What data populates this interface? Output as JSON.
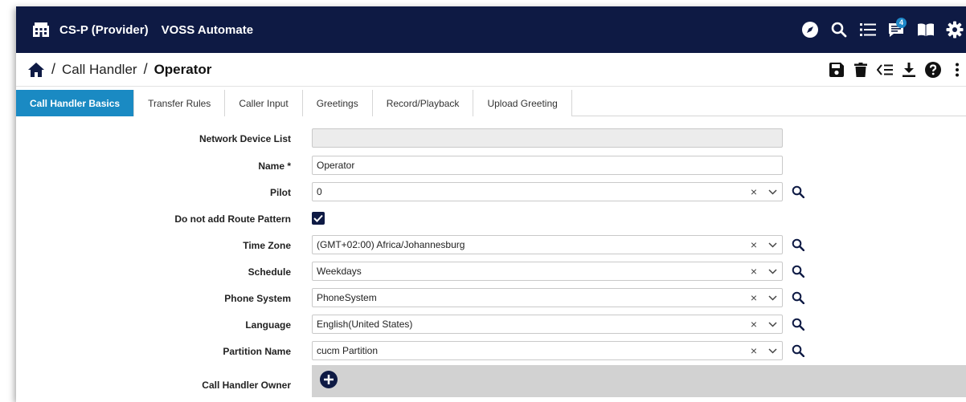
{
  "topbar": {
    "provider": "CS-P (Provider)",
    "product": "VOSS Automate",
    "notifications_count": "4",
    "icons": [
      "building-icon",
      "compass-icon",
      "search-icon",
      "list-icon",
      "chat-icon",
      "book-icon",
      "gear-icon"
    ]
  },
  "breadcrumb": {
    "separator": "/",
    "parent": "Call Handler",
    "current": "Operator"
  },
  "actions": [
    "save-icon",
    "delete-icon",
    "list-collapse-icon",
    "download-icon",
    "help-icon",
    "more-vertical-icon"
  ],
  "tabs": [
    {
      "label": "Call Handler Basics",
      "active": true
    },
    {
      "label": "Transfer Rules",
      "active": false
    },
    {
      "label": "Caller Input",
      "active": false
    },
    {
      "label": "Greetings",
      "active": false
    },
    {
      "label": "Record/Playback",
      "active": false
    },
    {
      "label": "Upload Greeting",
      "active": false
    }
  ],
  "form": {
    "network_device_list": {
      "label": "Network Device List",
      "value": ""
    },
    "name": {
      "label": "Name *",
      "value": "Operator"
    },
    "pilot": {
      "label": "Pilot",
      "value": "0"
    },
    "route_pattern": {
      "label": "Do not add Route Pattern",
      "checked": true
    },
    "time_zone": {
      "label": "Time Zone",
      "value": "(GMT+02:00) Africa/Johannesburg"
    },
    "schedule": {
      "label": "Schedule",
      "value": "Weekdays"
    },
    "phone_system": {
      "label": "Phone System",
      "value": "PhoneSystem"
    },
    "language": {
      "label": "Language",
      "value": "English(United States)"
    },
    "partition_name": {
      "label": "Partition Name",
      "value": "cucm Partition"
    },
    "owner": {
      "label": "Call Handler Owner"
    }
  },
  "colors": {
    "topbar_bg": "#0e1a44",
    "tab_active_bg": "#1a8ac3",
    "badge": "#1e88c9"
  }
}
